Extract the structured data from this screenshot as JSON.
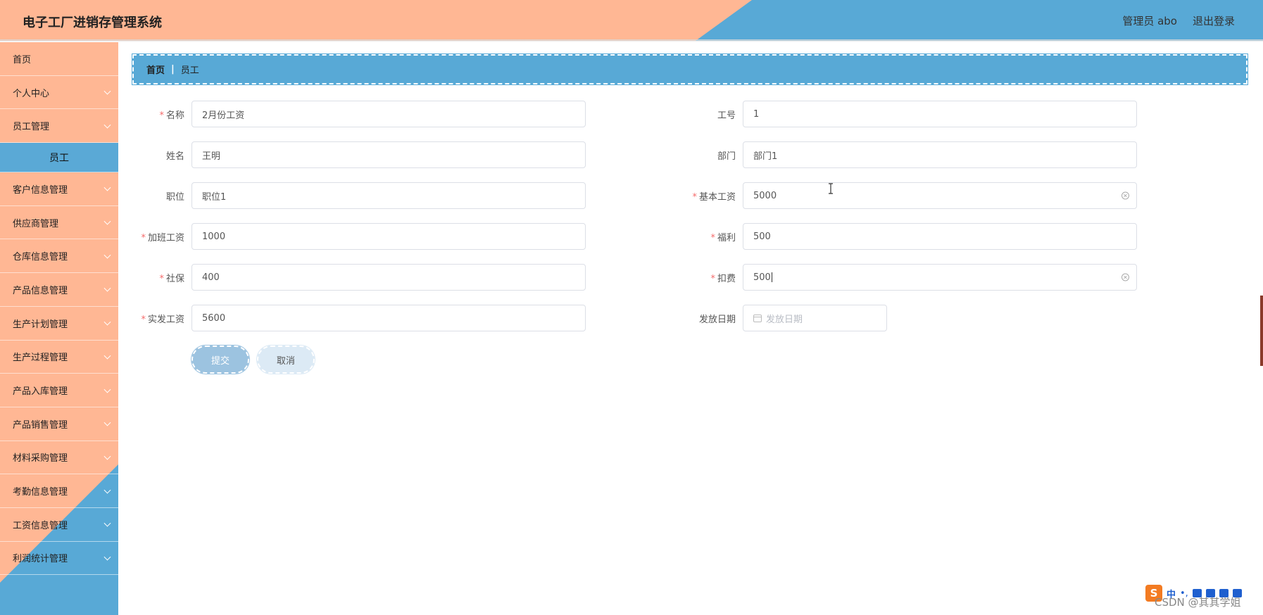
{
  "app": {
    "title": "电子工厂进销存管理系统",
    "admin_label": "管理员 abo",
    "logout_label": "退出登录",
    "colors": {
      "peach": "#ffb794",
      "blue": "#58a9d6",
      "required": "#f56c6c"
    }
  },
  "sidebar": {
    "items": [
      {
        "label": "首页",
        "expandable": false
      },
      {
        "label": "个人中心",
        "expandable": true
      },
      {
        "label": "员工管理",
        "expandable": true
      },
      {
        "label": "员工",
        "sub": true,
        "active": true
      },
      {
        "label": "客户信息管理",
        "expandable": true
      },
      {
        "label": "供应商管理",
        "expandable": true
      },
      {
        "label": "仓库信息管理",
        "expandable": true
      },
      {
        "label": "产品信息管理",
        "expandable": true
      },
      {
        "label": "生产计划管理",
        "expandable": true
      },
      {
        "label": "生产过程管理",
        "expandable": true
      },
      {
        "label": "产品入库管理",
        "expandable": true
      },
      {
        "label": "产品销售管理",
        "expandable": true
      },
      {
        "label": "材料采购管理",
        "expandable": true
      },
      {
        "label": "考勤信息管理",
        "expandable": true
      },
      {
        "label": "工资信息管理",
        "expandable": true
      },
      {
        "label": "利润统计管理",
        "expandable": true
      }
    ]
  },
  "breadcrumb": {
    "home": "首页",
    "separator": "|",
    "current": "员工"
  },
  "form": {
    "name": {
      "label": "名称",
      "required": true,
      "value": "2月份工资"
    },
    "employee_no": {
      "label": "工号",
      "required": false,
      "value": "1"
    },
    "full_name": {
      "label": "姓名",
      "required": false,
      "value": "王明"
    },
    "department": {
      "label": "部门",
      "required": false,
      "value": "部门1"
    },
    "position": {
      "label": "职位",
      "required": false,
      "value": "职位1"
    },
    "base_salary": {
      "label": "基本工资",
      "required": true,
      "value": "5000"
    },
    "overtime_pay": {
      "label": "加班工资",
      "required": true,
      "value": "1000"
    },
    "benefits": {
      "label": "福利",
      "required": true,
      "value": "500"
    },
    "social_security": {
      "label": "社保",
      "required": true,
      "value": "400"
    },
    "deduction": {
      "label": "扣费",
      "required": true,
      "value": "500"
    },
    "net_pay": {
      "label": "实发工资",
      "required": true,
      "value": "5600"
    },
    "pay_date": {
      "label": "发放日期",
      "required": false,
      "value": "",
      "placeholder": "发放日期"
    },
    "required_mark": "*"
  },
  "buttons": {
    "submit": "提交",
    "cancel": "取消"
  },
  "ime": {
    "logo": "S",
    "mode": "中",
    "punct": "•,"
  },
  "watermark": "CSDN @其其学姐"
}
